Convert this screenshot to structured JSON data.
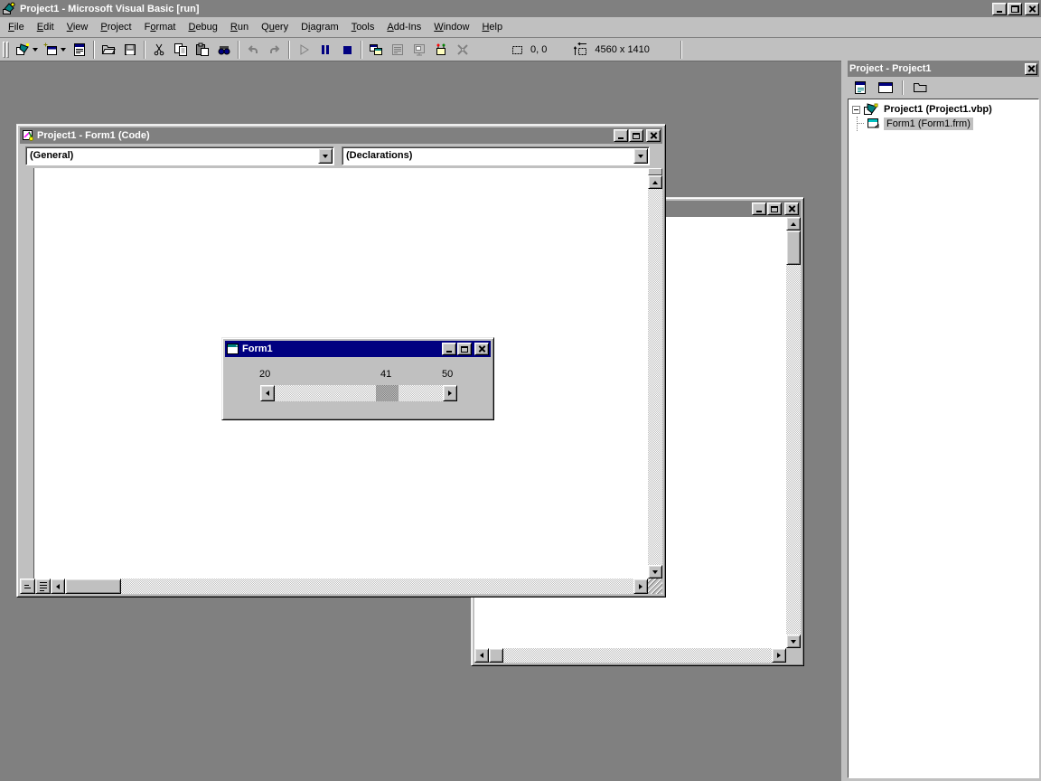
{
  "colors": {
    "desktop_background": "#808080",
    "window_chrome": "#c0c0c0",
    "active_titlebar": "#000080",
    "inactive_titlebar": "#808080",
    "titlebar_text": "#ffffff",
    "run_control_accent": "#000080",
    "inactive_selection": "#c0c0c0"
  },
  "main_window": {
    "app_icon": "vb-app-icon",
    "title": "Project1 - Microsoft Visual Basic [run]",
    "caption_buttons": [
      "minimize-icon",
      "restore-icon",
      "close-icon"
    ],
    "menu_items": [
      {
        "pre": "",
        "accel": "F",
        "post": "ile"
      },
      {
        "pre": "",
        "accel": "E",
        "post": "dit"
      },
      {
        "pre": "",
        "accel": "V",
        "post": "iew"
      },
      {
        "pre": "",
        "accel": "P",
        "post": "roject"
      },
      {
        "pre": "F",
        "accel": "o",
        "post": "rmat"
      },
      {
        "pre": "",
        "accel": "D",
        "post": "ebug"
      },
      {
        "pre": "",
        "accel": "R",
        "post": "un"
      },
      {
        "pre": "Q",
        "accel": "u",
        "post": "ery"
      },
      {
        "pre": "D",
        "accel": "i",
        "post": "agram"
      },
      {
        "pre": "",
        "accel": "T",
        "post": "ools"
      },
      {
        "pre": "",
        "accel": "A",
        "post": "dd-Ins"
      },
      {
        "pre": "",
        "accel": "W",
        "post": "indow"
      },
      {
        "pre": "",
        "accel": "H",
        "post": "elp"
      }
    ]
  },
  "toolbar": {
    "buttons": [
      {
        "name": "add-project-button",
        "icon": "add-project-icon",
        "dropdown": true
      },
      {
        "name": "add-form-button",
        "icon": "add-form-icon",
        "dropdown": true
      },
      {
        "name": "menu-editor-button",
        "icon": "menu-editor-icon"
      },
      {
        "sep": true
      },
      {
        "name": "open-project-button",
        "icon": "open-project-icon"
      },
      {
        "name": "save-project-button",
        "icon": "save-project-icon"
      },
      {
        "sep": true
      },
      {
        "name": "cut-button",
        "icon": "cut-icon"
      },
      {
        "name": "copy-button",
        "icon": "copy-icon"
      },
      {
        "name": "paste-button",
        "icon": "paste-icon"
      },
      {
        "name": "find-button",
        "icon": "find-icon"
      },
      {
        "sep": true
      },
      {
        "name": "undo-button",
        "icon": "undo-icon",
        "disabled": true
      },
      {
        "name": "redo-button",
        "icon": "redo-icon",
        "disabled": true
      },
      {
        "sep": true
      },
      {
        "name": "start-button",
        "icon": "start-icon",
        "disabled": true
      },
      {
        "name": "break-button",
        "icon": "break-icon"
      },
      {
        "name": "end-button",
        "icon": "end-icon"
      },
      {
        "sep": true
      },
      {
        "name": "project-explorer-button",
        "icon": "project-explorer-icon"
      },
      {
        "name": "properties-window-button",
        "icon": "properties-window-icon",
        "disabled": true
      },
      {
        "name": "form-layout-window-button",
        "icon": "form-layout-icon",
        "disabled": true
      },
      {
        "name": "object-browser-button",
        "icon": "object-browser-icon"
      },
      {
        "name": "toolbox-button",
        "icon": "toolbox-icon",
        "disabled": true
      }
    ],
    "position_indicator": {
      "icon": "position-icon",
      "value": "0, 0"
    },
    "size_indicator": {
      "icon": "size-icon",
      "value": "4560 x 1410"
    }
  },
  "code_window": {
    "icon": "code-window-icon",
    "title": "Project1 - Form1 (Code)",
    "caption_buttons": [
      "minimize-icon",
      "maximize-icon",
      "close-icon"
    ],
    "object_dropdown": {
      "value": "(General)"
    },
    "procedure_dropdown": {
      "value": "(Declarations)"
    },
    "view_buttons": [
      "procedure-view-icon",
      "full-module-view-icon"
    ]
  },
  "designer_window": {
    "caption_buttons": [
      "minimize-icon",
      "maximize-icon",
      "close-icon"
    ]
  },
  "form_window": {
    "icon": "form-icon",
    "title": "Form1",
    "caption_buttons": [
      "minimize-icon",
      "maximize-icon",
      "close-icon"
    ],
    "scrollbar_labels": {
      "min": "20",
      "value": "41",
      "max": "50"
    }
  },
  "project_explorer": {
    "title": "Project - Project1",
    "close_button": "close-icon",
    "toolbar_buttons": [
      {
        "name": "view-code-button",
        "icon": "view-code-icon"
      },
      {
        "name": "view-object-button",
        "icon": "view-object-icon"
      },
      {
        "sep": true
      },
      {
        "name": "toggle-folders-button",
        "icon": "toggle-folders-icon"
      }
    ],
    "tree": [
      {
        "label": "Project1 (Project1.vbp)",
        "icon": "vb-project-icon",
        "expander": "minus",
        "bold": true,
        "selected": false,
        "indent": 0
      },
      {
        "label": "Form1 (Form1.frm)",
        "icon": "form-file-icon",
        "bold": false,
        "selected": true,
        "indent": 1
      }
    ]
  }
}
